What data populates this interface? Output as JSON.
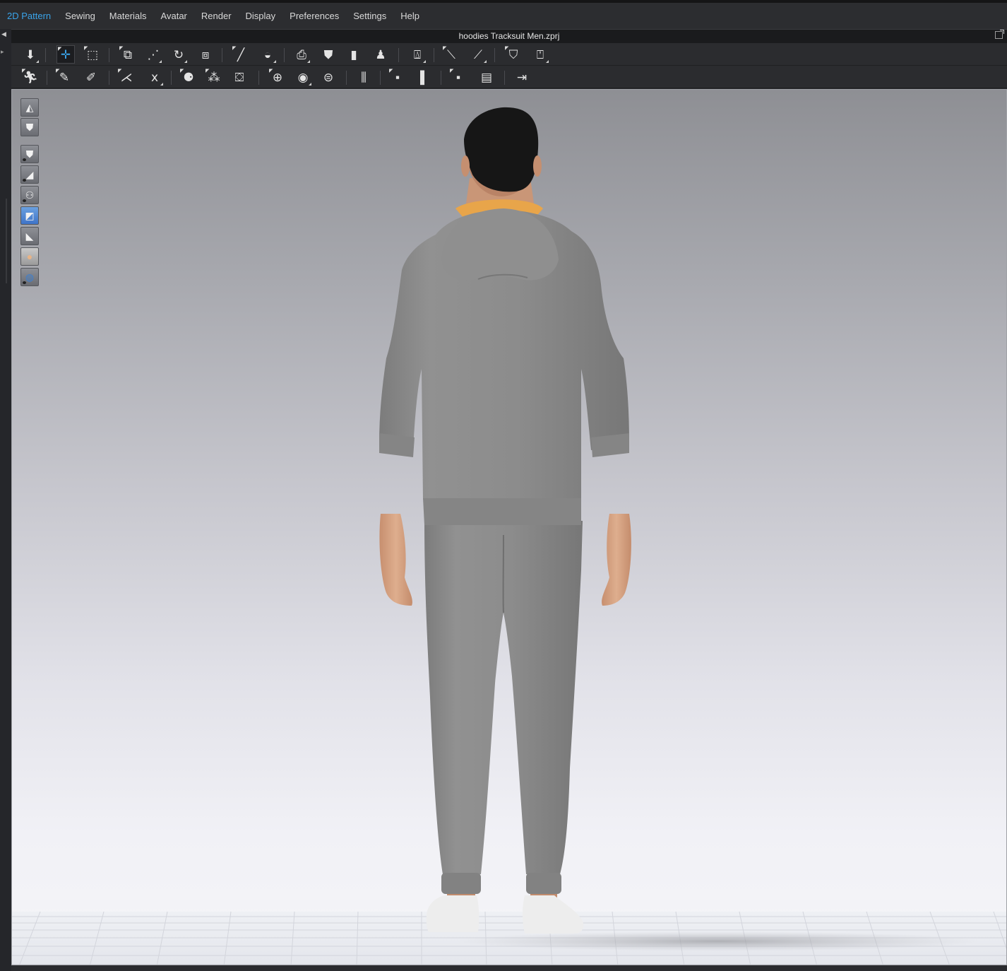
{
  "menu": [
    {
      "label": "2D Pattern",
      "active": true
    },
    {
      "label": "Sewing",
      "active": false
    },
    {
      "label": "Materials",
      "active": false
    },
    {
      "label": "Avatar",
      "active": false
    },
    {
      "label": "Render",
      "active": false
    },
    {
      "label": "Display",
      "active": false
    },
    {
      "label": "Preferences",
      "active": false
    },
    {
      "label": "Settings",
      "active": false
    },
    {
      "label": "Help",
      "active": false
    }
  ],
  "window": {
    "title": "hoodies Tracksuit Men.zprj"
  },
  "colors": {
    "accent": "#3aa4ea",
    "menubar": "#2c2d30",
    "toolbar": "#2b2c2f",
    "garment_gray": "#8a8a8a",
    "hood_lining": "#e8a54a",
    "skin": "#d9a98a",
    "hair": "#1a1a1a",
    "floor": "#eef0f4"
  },
  "toolbar1_icons": [
    "simulate-icon",
    "select-move-icon",
    "box-select-icon",
    "transform-pattern-icon",
    "edit-pattern-icon",
    "edit-curvature-icon",
    "fold-arrangement-icon",
    "line-tool-icon",
    "sewing-tool-icon",
    "pattern-arrangement-icon",
    "garment-front-icon",
    "garment-back-icon",
    "garment-shape-icon",
    "fitting-suit-icon",
    "tape-measure-icon",
    "ruler-icon",
    "pin-garment-icon",
    "garment-fit-map-icon"
  ],
  "toolbar2_icons": [
    "pose-icon",
    "pin-icon",
    "pin-multiple-icon",
    "strap-icon",
    "tack-icon",
    "puckering-icon",
    "shirring-icon",
    "knit-icon",
    "button-icon",
    "button-hole-icon",
    "snap-button-icon",
    "zipper-icon",
    "topstitch-icon",
    "topstitch-segment-icon",
    "graphic-icon",
    "texture-icon",
    "seam-taping-icon"
  ],
  "viewport_tools": [
    "show-3d-garment-icon",
    "show-garment-icon",
    "garment-visibility-icon",
    "avatar-visibility-icon",
    "avatar-display-icon",
    "render-style-icon",
    "shading-icon",
    "skin-texture-icon",
    "environment-icon"
  ]
}
